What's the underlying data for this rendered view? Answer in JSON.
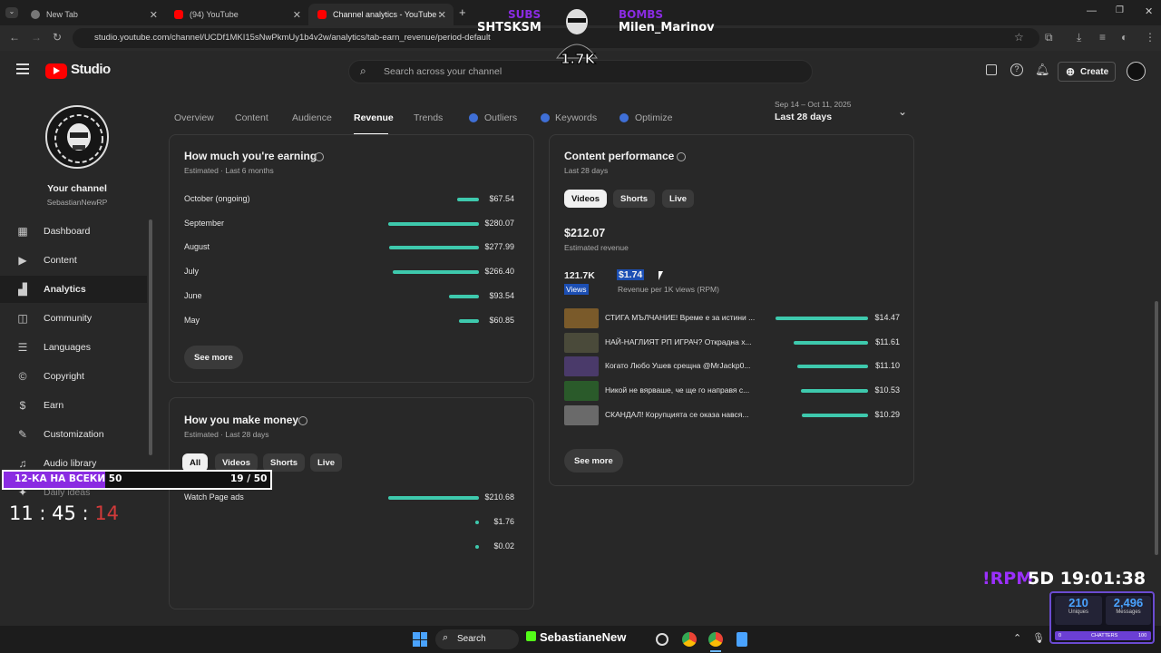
{
  "browser": {
    "tabs": [
      {
        "title": "New Tab",
        "active": false
      },
      {
        "title": "(94) YouTube",
        "active": false
      },
      {
        "title": "Channel analytics - YouTube St...",
        "active": true
      }
    ],
    "url": "studio.youtube.com/channel/UCDf1MKI15sNwPkmUy1b4v2w/analytics/tab-earn_revenue/period-default"
  },
  "header": {
    "logo": "Studio",
    "search_placeholder": "Search across your channel",
    "create_label": "Create"
  },
  "sidebar": {
    "channel_label": "Your channel",
    "channel_name": "SebastianNewRP",
    "items": [
      {
        "label": "Dashboard",
        "icon": "dashboard-icon"
      },
      {
        "label": "Content",
        "icon": "content-icon"
      },
      {
        "label": "Analytics",
        "icon": "analytics-icon"
      },
      {
        "label": "Community",
        "icon": "community-icon"
      },
      {
        "label": "Languages",
        "icon": "languages-icon"
      },
      {
        "label": "Copyright",
        "icon": "copyright-icon"
      },
      {
        "label": "Earn",
        "icon": "earn-icon"
      },
      {
        "label": "Customization",
        "icon": "customization-icon"
      },
      {
        "label": "Audio library",
        "icon": "audio-library-icon"
      },
      {
        "label": "Daily ideas",
        "icon": "ideas-icon"
      }
    ]
  },
  "tabs": [
    "Overview",
    "Content",
    "Audience",
    "Revenue",
    "Trends",
    "Outliers",
    "Keywords",
    "Optimize"
  ],
  "date_range": {
    "range": "Sep 14 – Oct 11, 2025",
    "label": "Last 28 days"
  },
  "earning": {
    "title": "How much you're earning",
    "subtitle": "Estimated · Last 6 months",
    "rows": [
      {
        "month": "October (ongoing)",
        "value": "$67.54",
        "amount": 67.54
      },
      {
        "month": "September",
        "value": "$280.07",
        "amount": 280.07
      },
      {
        "month": "August",
        "value": "$277.99",
        "amount": 277.99
      },
      {
        "month": "July",
        "value": "$266.40",
        "amount": 266.4
      },
      {
        "month": "June",
        "value": "$93.54",
        "amount": 93.54
      },
      {
        "month": "May",
        "value": "$60.85",
        "amount": 60.85
      }
    ],
    "see_more": "See more"
  },
  "money": {
    "title": "How you make money",
    "subtitle": "Estimated · Last 28 days",
    "filters": [
      "All",
      "Videos",
      "Shorts",
      "Live"
    ],
    "rows": [
      {
        "label": "Watch Page ads",
        "value": "$210.68",
        "amount": 210.68
      },
      {
        "label": "",
        "value": "$1.76",
        "amount": 1.76
      },
      {
        "label": "",
        "value": "$0.02",
        "amount": 0.02
      }
    ]
  },
  "performance": {
    "title": "Content performance",
    "subtitle": "Last 28 days",
    "filters": [
      "Videos",
      "Shorts",
      "Live"
    ],
    "revenue": "$212.07",
    "revenue_label": "Estimated revenue",
    "views": "121.7K",
    "views_label": "Views",
    "rpm": "$1.74",
    "rpm_label": "Revenue per 1K views (RPM)",
    "videos": [
      {
        "title": "СТИГА МЪЛЧАНИЕ! Време е за истини ...",
        "value": "$14.47",
        "amount": 14.47
      },
      {
        "title": "НАЙ-НАГЛИЯТ РП ИГРАЧ? Открадна х...",
        "value": "$11.61",
        "amount": 11.61
      },
      {
        "title": "Когато Любо Ушев срещна @MrJackp0...",
        "value": "$11.10",
        "amount": 11.1
      },
      {
        "title": "Никой не вярваше, че ще го направя с...",
        "value": "$10.53",
        "amount": 10.53
      },
      {
        "title": "СКАНДАЛ! Корупцията се оказа нався...",
        "value": "$10.29",
        "amount": 10.29
      }
    ],
    "see_more": "See more"
  },
  "stream_overlay": {
    "subs_label": "SUBS",
    "subs_name": "SHTSKSM",
    "bombs_label": "BOMBS",
    "bombs_name": "Milen_Marinov",
    "count": "1.7K",
    "goal_label": "12-КА НА ВСЕКИ 50",
    "goal_progress": "19 / 50",
    "timer_main": "11 : 45 :",
    "timer_sec": "14",
    "command": "!RPM",
    "clock": "5D 19:01:38",
    "uniques": "210",
    "uniques_label": "Uniques",
    "messages": "2,496",
    "messages_label": "Messages",
    "chatters_min": "0",
    "chatters_label": "CHATTERS",
    "chatters_max": "100"
  },
  "taskbar": {
    "search": "Search",
    "app_label": "SebastianeNew"
  },
  "colors": {
    "bar": "#3ec9ad",
    "accent_red": "#ff0000",
    "overlay_purple": "#8a2be2"
  }
}
